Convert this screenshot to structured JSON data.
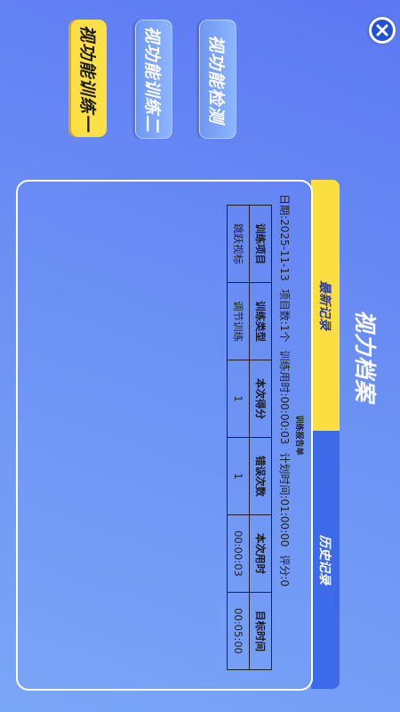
{
  "page_title": "视力档案",
  "function_buttons": {
    "active": "视功能训练一",
    "second": "视功能训练二",
    "third": "视功能检测"
  },
  "tabs": {
    "latest": "最新记录",
    "history": "历史记录"
  },
  "report": {
    "title": "训练报告单",
    "date": "日期:2025-11-13",
    "item_count": "项目数:1个",
    "training_time": "训练用时:00:00:03",
    "planned_time": "计划时间:01:00:00",
    "score": "评分:0",
    "headers": [
      "训练项目",
      "训练类型",
      "本次得分",
      "错误次数",
      "本次用时",
      "目标时间"
    ],
    "rows": [
      [
        "跳跃视标",
        "调节训练",
        "1",
        "1",
        "00:00:03",
        "00:05:00"
      ]
    ]
  },
  "colors": {
    "accent_yellow": "#fbde3f",
    "tab_blue": "#3c6ae8",
    "close_blue": "#2450d6"
  },
  "icons": {
    "close": "close-icon"
  }
}
